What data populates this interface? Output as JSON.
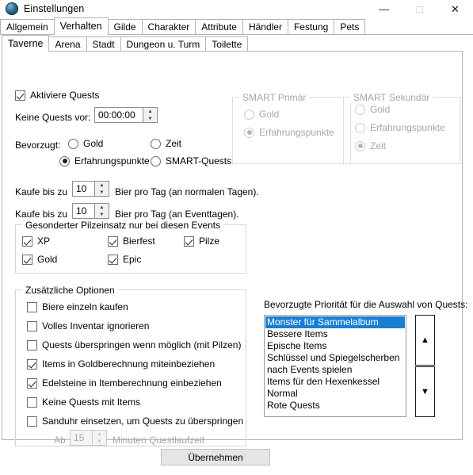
{
  "window": {
    "title": "Einstellungen",
    "icon": "globe-icon",
    "minimize_label": "—",
    "maximize_label": "□",
    "close_label": "✕"
  },
  "main_tabs": {
    "active": "Verhalten",
    "items": [
      {
        "label": "Allgemein"
      },
      {
        "label": "Verhalten"
      },
      {
        "label": "Gilde"
      },
      {
        "label": "Charakter"
      },
      {
        "label": "Attribute"
      },
      {
        "label": "Händler"
      },
      {
        "label": "Festung"
      },
      {
        "label": "Pets"
      }
    ]
  },
  "sub_tabs": {
    "active": "Taverne",
    "items": [
      {
        "label": "Taverne"
      },
      {
        "label": "Arena"
      },
      {
        "label": "Stadt"
      },
      {
        "label": "Dungeon u. Turm"
      },
      {
        "label": "Toilette"
      }
    ]
  },
  "quests": {
    "enable_label": "Aktiviere Quests",
    "enable_checked": true,
    "no_quests_before_label": "Keine Quests vor:",
    "no_quests_before_value": "00:00:00",
    "preferred_label": "Bevorzugt:",
    "options": [
      {
        "label": "Gold",
        "selected": false
      },
      {
        "label": "Zeit",
        "selected": false
      },
      {
        "label": "Erfahrungspunkte",
        "selected": true
      },
      {
        "label": "SMART-Quests",
        "selected": false
      }
    ]
  },
  "smart_primary": {
    "title": "SMART Primär",
    "disabled": true,
    "options": [
      {
        "label": "Gold",
        "selected": false
      },
      {
        "label": "Erfahrungspunkte",
        "selected": true
      }
    ]
  },
  "smart_secondary": {
    "title": "SMART Sekundär",
    "disabled": true,
    "options": [
      {
        "label": "Gold",
        "selected": false
      },
      {
        "label": "Erfahrungspunkte",
        "selected": false
      },
      {
        "label": "Zeit",
        "selected": true
      }
    ]
  },
  "beer": {
    "rows": [
      {
        "prefix": "Kaufe bis zu",
        "value": "10",
        "suffix": "Bier pro Tag (an normalen Tagen)."
      },
      {
        "prefix": "Kaufe bis zu",
        "value": "10",
        "suffix": "Bier pro Tag (an Eventtagen)."
      }
    ]
  },
  "mushroom_events": {
    "title": "Gesonderter Pilzeinsatz nur bei diesen Events",
    "items": [
      {
        "label": "XP",
        "checked": true
      },
      {
        "label": "Bierfest",
        "checked": true
      },
      {
        "label": "Pilze",
        "checked": true
      },
      {
        "label": "Gold",
        "checked": true
      },
      {
        "label": "Epic",
        "checked": true
      }
    ]
  },
  "extra_options": {
    "title": "Zusätzliche Optionen",
    "items": [
      {
        "label": "Biere einzeln kaufen",
        "checked": false
      },
      {
        "label": "Volles Inventar ignorieren",
        "checked": false
      },
      {
        "label": "Quests überspringen wenn möglich (mit Pilzen)",
        "checked": false
      },
      {
        "label": "Items in Goldberechnung miteinbeziehen",
        "checked": true
      },
      {
        "label": "Edelsteine in Itemberechnung einbeziehen",
        "checked": true
      },
      {
        "label": "Keine Quests mit Items",
        "checked": false
      },
      {
        "label": "Sanduhr einsetzen, um Quests zu überspringen",
        "checked": false
      }
    ],
    "hourglass_from_label": "Ab",
    "hourglass_value": "15",
    "hourglass_suffix": "Minuten Questlaufzeit",
    "hourglass_disabled": true
  },
  "priority": {
    "label": "Bevorzugte Priorität für die Auswahl von Quests:",
    "selected_index": 0,
    "items": [
      {
        "label": "Monster für Sammelalbum"
      },
      {
        "label": "Bessere Items"
      },
      {
        "label": "Epische Items"
      },
      {
        "label": "Schlüssel und Spiegelscherben"
      },
      {
        "label": "nach Events spielen"
      },
      {
        "label": "Items für den Hexenkessel"
      },
      {
        "label": "Normal"
      },
      {
        "label": "Rote Quests"
      }
    ],
    "move_up_label": "▲",
    "move_down_label": "▼"
  },
  "footer": {
    "apply_label": "Übernehmen"
  },
  "colors": {
    "selection_blue": "#1a7fd4",
    "border_gray": "#b4b4b4",
    "group_border": "#d4d4d4",
    "disabled_text": "#a6a6a6"
  }
}
